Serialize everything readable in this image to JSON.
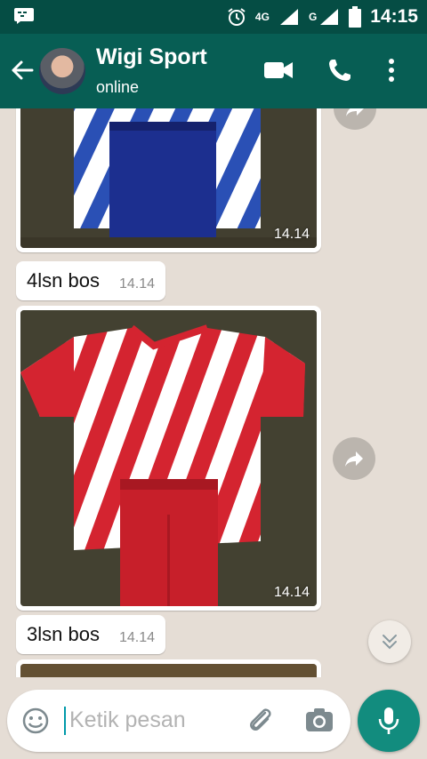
{
  "status_bar": {
    "time": "14:15",
    "network_1": "4G",
    "network_2": "G"
  },
  "header": {
    "contact_name": "Wigi Sport",
    "status": "online"
  },
  "messages": [
    {
      "type": "image",
      "time": "14.14",
      "jersey": "blue-white"
    },
    {
      "type": "text",
      "text": "4lsn bos",
      "time": "14.14"
    },
    {
      "type": "image",
      "time": "14.14",
      "jersey": "red-white"
    },
    {
      "type": "text",
      "text": "3lsn bos",
      "time": "14.14"
    },
    {
      "type": "image",
      "time": "",
      "jersey": "partial"
    }
  ],
  "input": {
    "placeholder": "Ketik pesan"
  },
  "colors": {
    "header": "#075e54",
    "status_bar": "#054d44",
    "chat_background": "#e5ddd5",
    "accent": "#128c7e"
  }
}
